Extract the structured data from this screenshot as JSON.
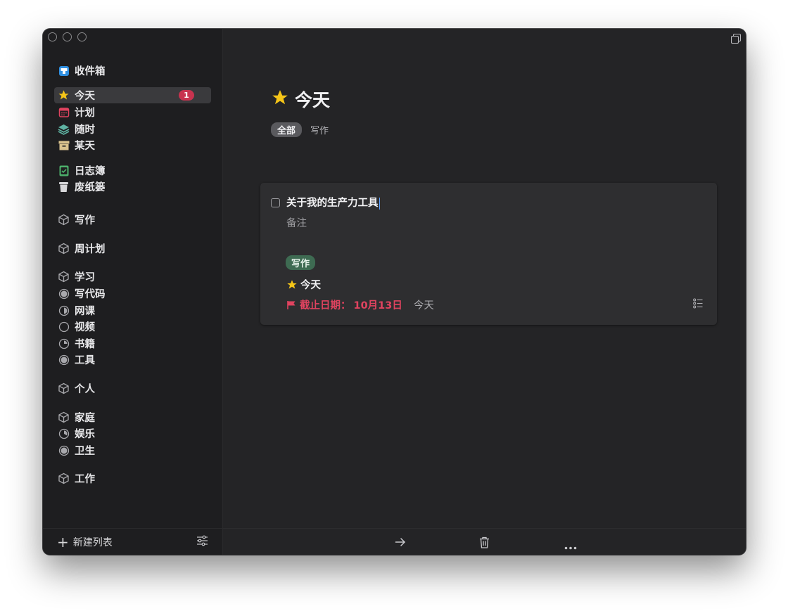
{
  "sidebar": {
    "items": [
      {
        "label": "收件箱"
      },
      {
        "label": "今天",
        "badge": "1"
      },
      {
        "label": "计划"
      },
      {
        "label": "随时"
      },
      {
        "label": "某天"
      },
      {
        "label": "日志簿"
      },
      {
        "label": "废纸篓"
      },
      {
        "label": "写作"
      },
      {
        "label": "周计划"
      },
      {
        "label": "学习"
      },
      {
        "label": "写代码"
      },
      {
        "label": "网课"
      },
      {
        "label": "视频"
      },
      {
        "label": "书籍"
      },
      {
        "label": "工具"
      },
      {
        "label": "个人"
      },
      {
        "label": "家庭"
      },
      {
        "label": "娱乐"
      },
      {
        "label": "卫生"
      },
      {
        "label": "工作"
      }
    ],
    "new_list_label": "新建列表"
  },
  "main": {
    "title": "今天",
    "filters": [
      "全部",
      "写作"
    ],
    "task": {
      "title": "关于我的生产力工具",
      "notes_placeholder": "备注",
      "tag": "写作",
      "when": "今天",
      "deadline_label": "截止日期：",
      "deadline_date": "10月13日",
      "deadline_relative": "今天"
    }
  },
  "colors": {
    "accent_badge": "#c8334f",
    "deadline": "#e0435f",
    "tag_bg": "#3e6b52",
    "star": "#f5c518"
  }
}
